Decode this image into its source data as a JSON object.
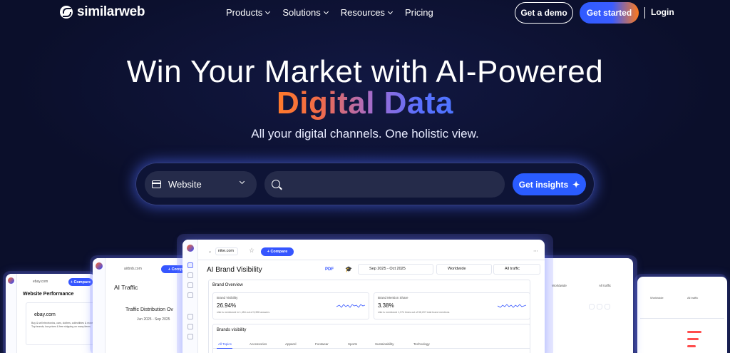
{
  "brand": {
    "name": "similarweb"
  },
  "nav": {
    "menu": [
      {
        "label": "Products",
        "has_dropdown": true
      },
      {
        "label": "Solutions",
        "has_dropdown": true
      },
      {
        "label": "Resources",
        "has_dropdown": true
      },
      {
        "label": "Pricing",
        "has_dropdown": false
      }
    ],
    "demo_label": "Get a demo",
    "start_label": "Get started",
    "login_label": "Login"
  },
  "hero": {
    "title_line1": "Win Your Market with AI-Powered",
    "title_line2": "Digital Data",
    "subtitle": "All your digital channels. One holistic view."
  },
  "search": {
    "type_selected": "Website",
    "input_value": "",
    "input_placeholder": "",
    "submit_label": "Get insights",
    "submit_icon": "sparkle-icon"
  },
  "colors": {
    "background": "#0b0f2b",
    "primary": "#2a5cff",
    "accent_orange": "#ff7a1a",
    "input_bg": "#252b4a"
  },
  "preview": {
    "main": {
      "domain": "nike.com",
      "compare_label": "+ Compare",
      "title": "AI Brand Visibility",
      "pdf_label": "PDF",
      "date_range": "Sep 2025 - Oct 2025",
      "region": "Worldwide",
      "traffic": "All traffic",
      "section_title": "Brand Overview",
      "metric1_label": "Brand Visibility",
      "metric1_value": "26.94%",
      "metric1_note": "nike is mentioned in 1,454 out of 5,398 answers",
      "metric2_label": "Brand Mention Share",
      "metric2_value": "3.38%",
      "metric2_note": "nike is mentioned 1,974 times out of 58,207 total brand mentions",
      "brands_title": "Brands visibility",
      "tabs": [
        "All Topics",
        "Accessories",
        "Apparel",
        "Footwear",
        "Sports",
        "Sustainability",
        "Technology"
      ]
    },
    "left2": {
      "domain": "airbnb.com",
      "title": "AI Traffic",
      "chart_title": "Traffic Distribution Ov",
      "date_range": "Jun 2025 - Sep 2025"
    },
    "left1": {
      "domain": "ebay.com",
      "compare_label": "+ Compare",
      "title": "Website Performance",
      "site": "ebay.com",
      "desc1": "Buy & sell electronics, cars, clothes, collectibles & more",
      "desc2": "Top brands, low prices & free shipping on many items"
    },
    "right2": {
      "region": "Worldwide",
      "traffic": "All traffic"
    },
    "right1": {
      "region": "Worldwide",
      "traffic": "All traffic"
    }
  }
}
